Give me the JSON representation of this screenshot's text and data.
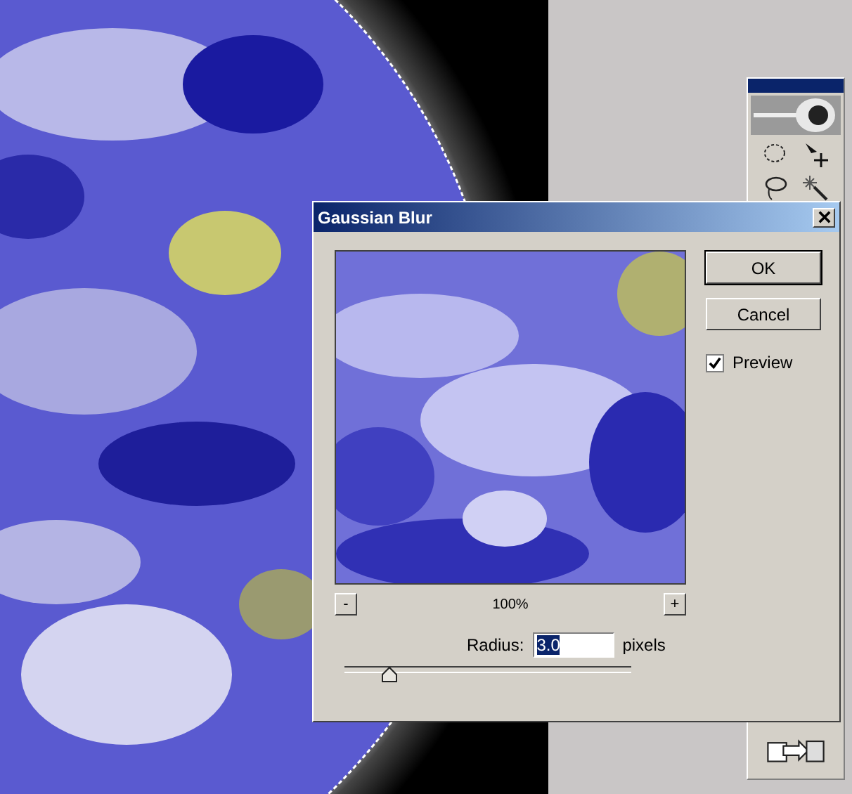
{
  "dialog": {
    "title": "Gaussian Blur",
    "zoom": {
      "minus": "-",
      "value": "100%",
      "plus": "+"
    },
    "buttons": [
      "OK",
      "Cancel"
    ],
    "preview": {
      "label": "Preview",
      "checked": true
    },
    "radius": {
      "label": "Radius:",
      "value": "3.0",
      "unit": "pixels",
      "level": 0.15
    }
  }
}
